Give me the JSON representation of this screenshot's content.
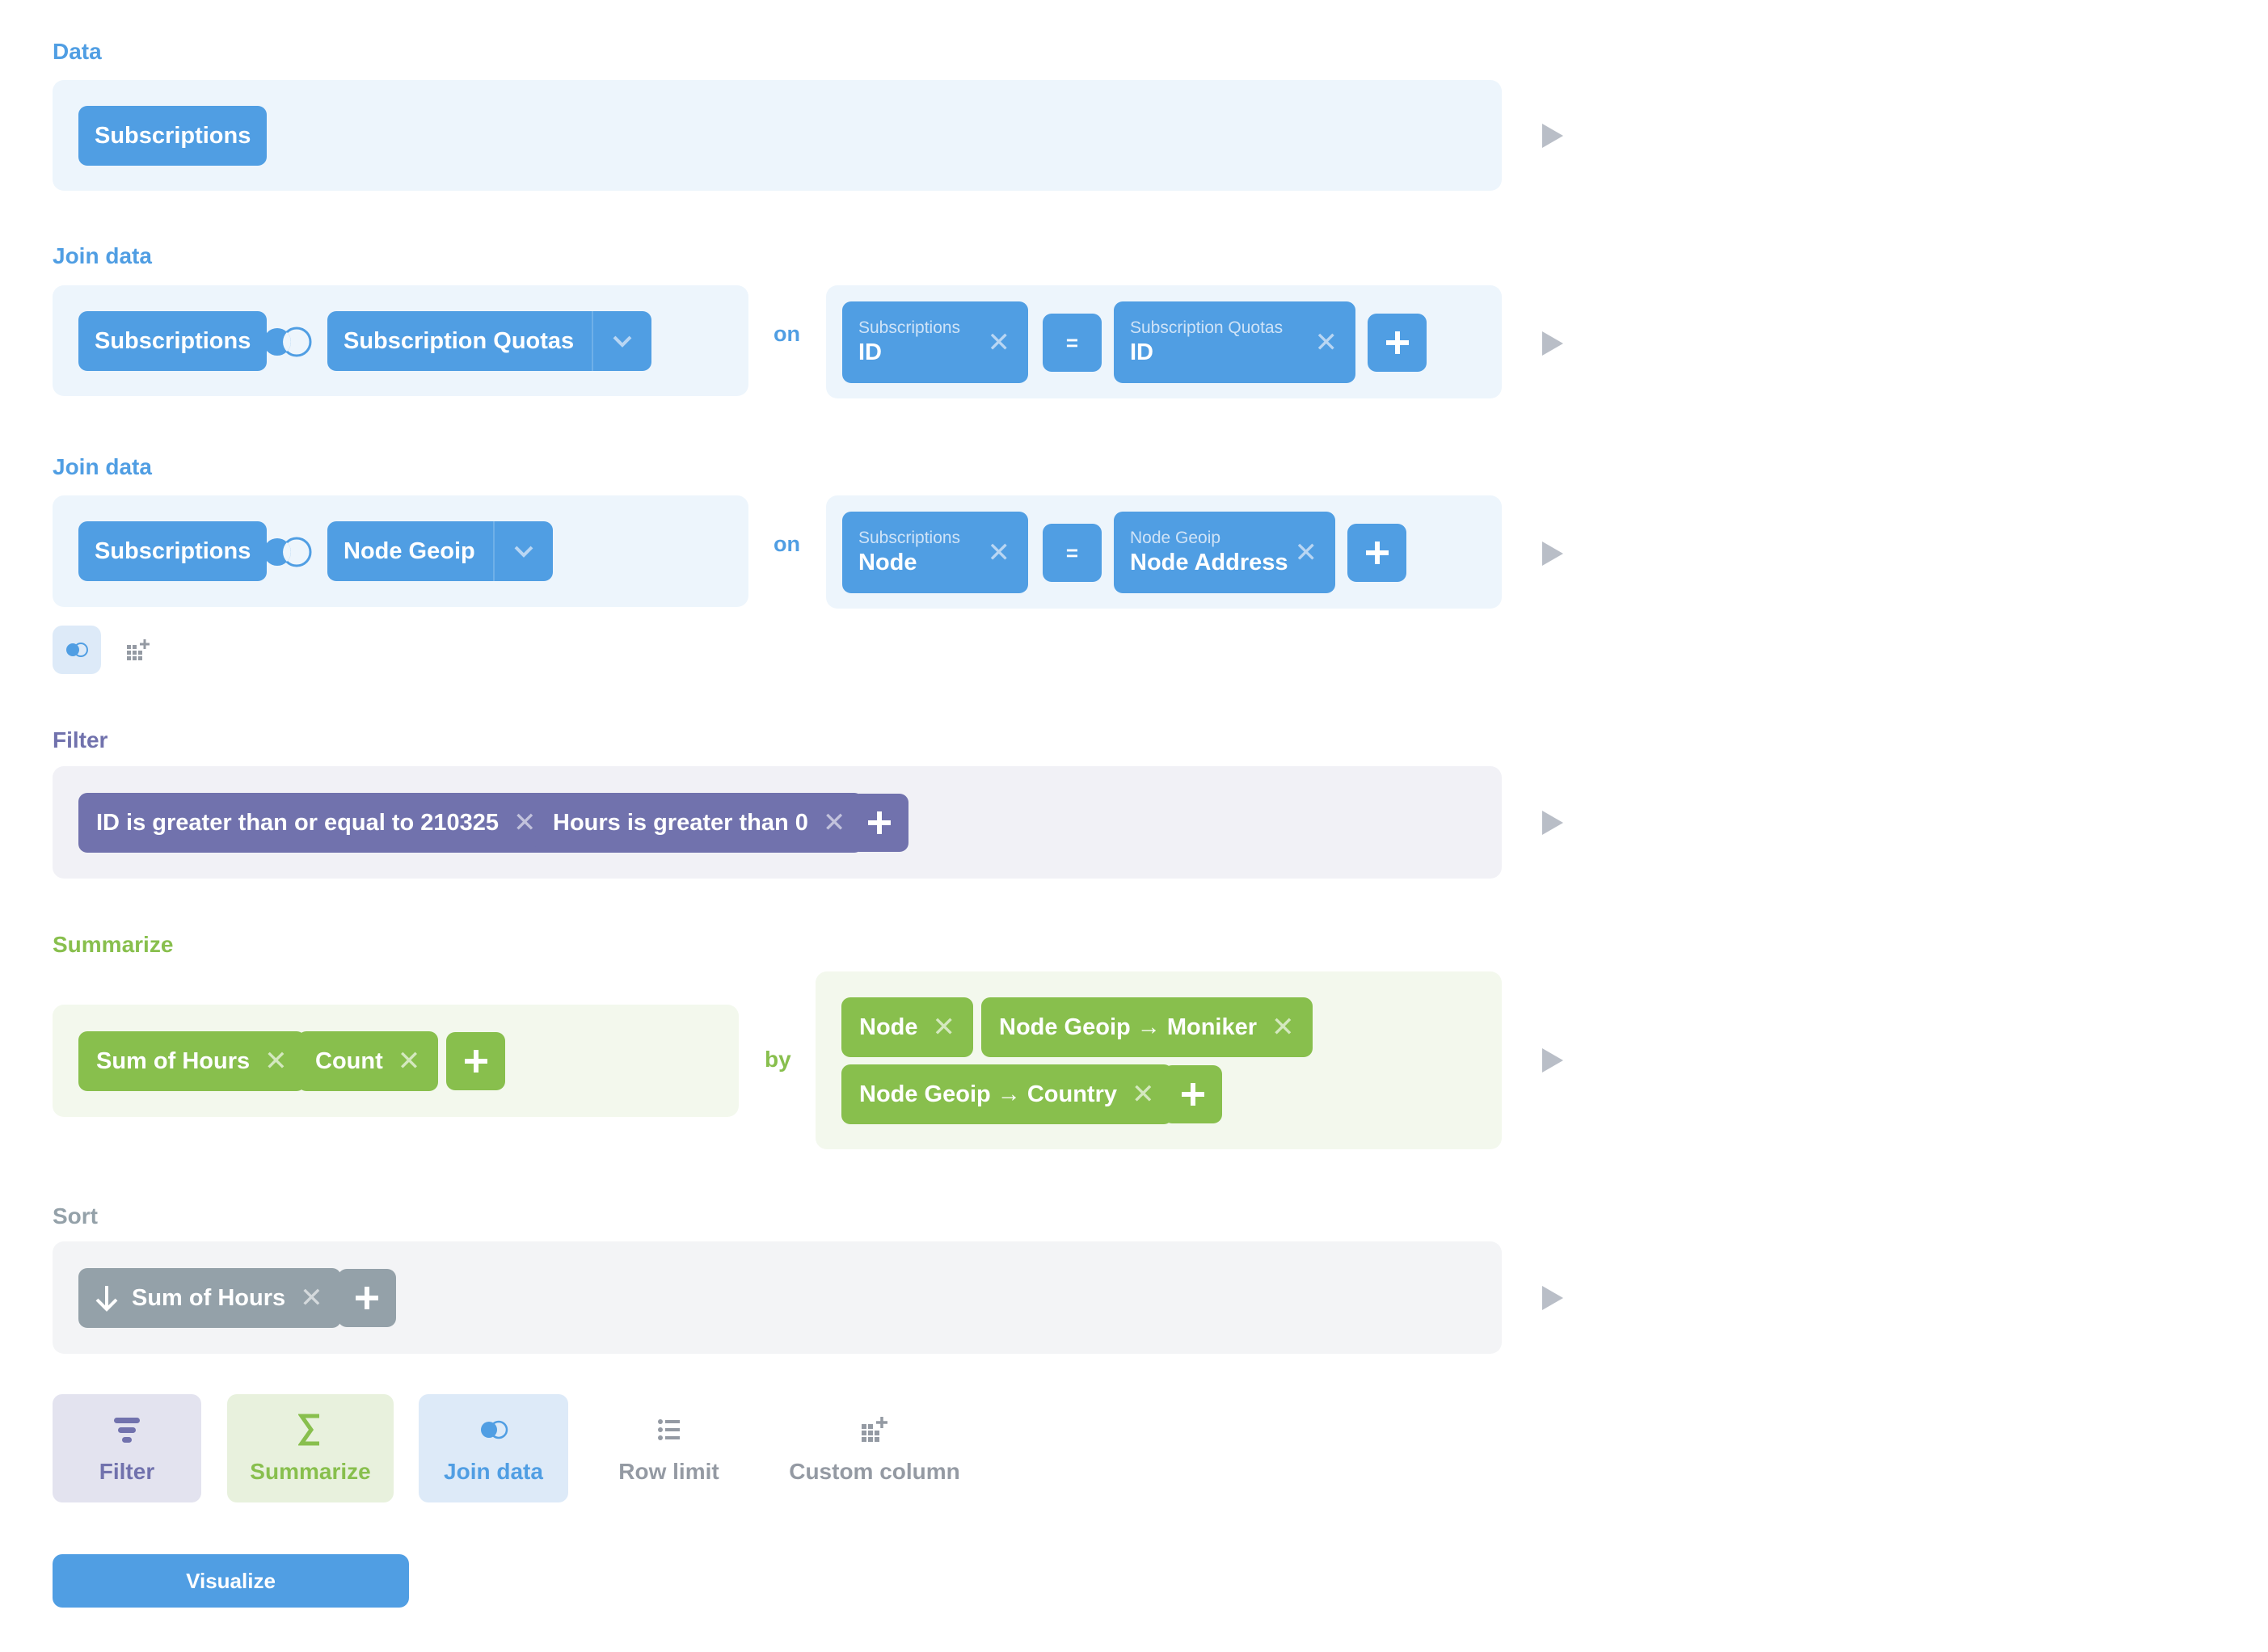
{
  "colors": {
    "data": "#509ee3",
    "filter": "#7172ad",
    "summarize": "#88bf4d",
    "sort": "#94a1a9"
  },
  "data_step": {
    "label": "Data",
    "table": "Subscriptions"
  },
  "joins": [
    {
      "label": "Join data",
      "left_table": "Subscriptions",
      "join_type_icon": "venn-left-join-icon",
      "right_table": "Subscription Quotas",
      "on_label": "on",
      "left_field": {
        "table": "Subscriptions",
        "column": "ID"
      },
      "operator": "=",
      "right_field": {
        "table": "Subscription Quotas",
        "column": "ID"
      }
    },
    {
      "label": "Join data",
      "left_table": "Subscriptions",
      "join_type_icon": "venn-left-join-icon",
      "right_table": "Node Geoip",
      "on_label": "on",
      "left_field": {
        "table": "Subscriptions",
        "column": "Node"
      },
      "operator": "=",
      "right_field": {
        "table": "Node Geoip",
        "column": "Node Address"
      }
    }
  ],
  "inline_actions": [
    {
      "name": "join-data",
      "icon": "venn-icon"
    },
    {
      "name": "custom-column",
      "icon": "grid-plus-icon"
    }
  ],
  "filter": {
    "label": "Filter",
    "items": [
      "ID is greater than or equal to 210325",
      "Hours is greater than 0"
    ]
  },
  "summarize": {
    "label": "Summarize",
    "metrics": [
      "Sum of Hours",
      "Count"
    ],
    "by_label": "by",
    "breakouts": [
      "Node",
      "Node Geoip → Moniker",
      "Node Geoip → Country"
    ]
  },
  "sort": {
    "label": "Sort",
    "items": [
      {
        "direction": "descending",
        "field": "Sum of Hours"
      }
    ]
  },
  "actions": [
    {
      "label": "Filter",
      "icon": "filter-icon"
    },
    {
      "label": "Summarize",
      "icon": "sigma-icon"
    },
    {
      "label": "Join data",
      "icon": "venn-icon"
    },
    {
      "label": "Row limit",
      "icon": "list-icon"
    },
    {
      "label": "Custom column",
      "icon": "grid-plus-icon"
    }
  ],
  "visualize_label": "Visualize",
  "remove_glyph": "✕"
}
